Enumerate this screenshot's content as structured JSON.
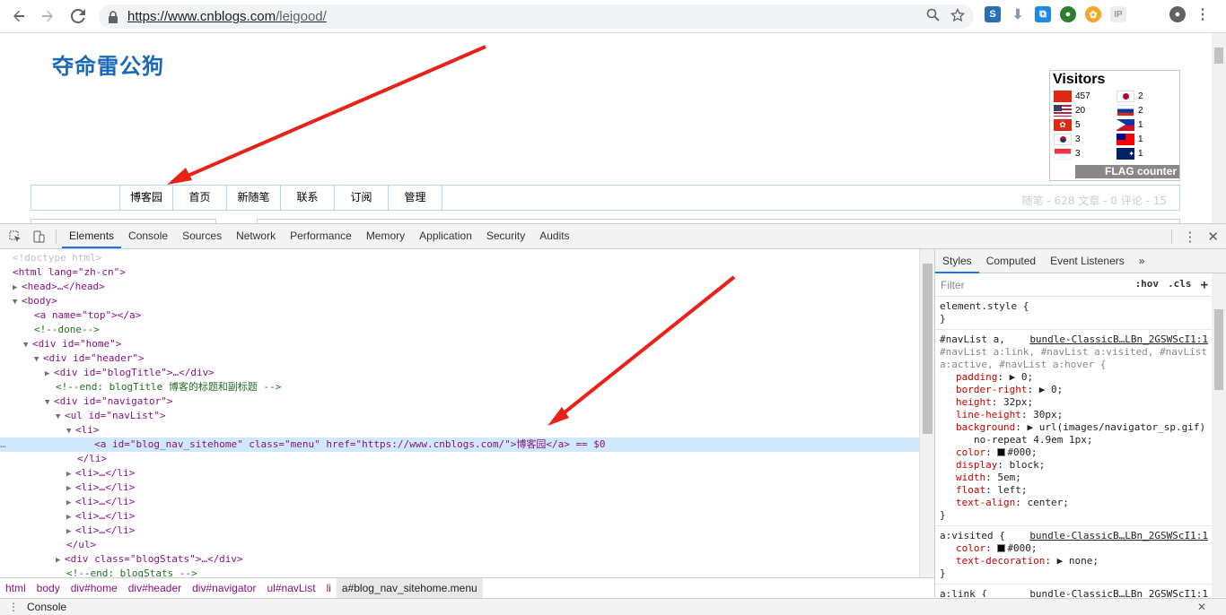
{
  "browser": {
    "url_host": "https://www.cnblogs.com",
    "url_path": "/leigood/"
  },
  "page": {
    "blog_title": "夺命雷公狗",
    "nav_items": [
      "博客园",
      "首页",
      "新随笔",
      "联系",
      "订阅",
      "管理"
    ],
    "blog_stats": "随笔 - 628  文章 - 0  评论 - 15"
  },
  "flag_counter": {
    "title": "Visitors",
    "rows": [
      {
        "flag": "china",
        "count": "457"
      },
      {
        "flag": "usa",
        "count": "20"
      },
      {
        "flag": "hongkong",
        "count": "5"
      },
      {
        "flag": "korea",
        "count": "3"
      },
      {
        "flag": "singapore",
        "count": "3"
      },
      {
        "flag": "japan",
        "count": "2"
      },
      {
        "flag": "russia",
        "count": "2"
      },
      {
        "flag": "philippines",
        "count": "1"
      },
      {
        "flag": "taiwan",
        "count": "1"
      },
      {
        "flag": "australia",
        "count": "1"
      }
    ],
    "logo_text": "FLAG counter"
  },
  "devtools": {
    "tabs": [
      "Elements",
      "Console",
      "Sources",
      "Network",
      "Performance",
      "Memory",
      "Application",
      "Security",
      "Audits"
    ],
    "active_tab": "Elements",
    "dom_lines": [
      {
        "text": "<!doctype html>"
      },
      {
        "text": "<html lang=\"zh-cn\">"
      },
      {
        "text": "<head>…</head>"
      },
      {
        "text": "<body>"
      },
      {
        "text": "<a name=\"top\"></a>"
      },
      {
        "text": "<!--done-->"
      },
      {
        "text": "<div id=\"home\">"
      },
      {
        "text": "<div id=\"header\">"
      },
      {
        "text": "<div id=\"blogTitle\">…</div>"
      },
      {
        "text": "<!--end: blogTitle 博客的标题和副标题 -->"
      },
      {
        "text": "<div id=\"navigator\">"
      },
      {
        "text": "<ul id=\"navList\">"
      },
      {
        "text": "<li>"
      },
      {
        "text": "<a id=\"blog_nav_sitehome\" class=\"menu\" href=\"https://www.cnblogs.com/\">博客园</a> == $0"
      },
      {
        "text": "</li>"
      },
      {
        "text": "<li>…</li>"
      },
      {
        "text": "<li>…</li>"
      },
      {
        "text": "<li>…</li>"
      },
      {
        "text": "<li>…</li>"
      },
      {
        "text": "<li>…</li>"
      },
      {
        "text": "</ul>"
      },
      {
        "text": "<div class=\"blogStats\">…</div>"
      },
      {
        "text": "<!--end: blogStats -->"
      }
    ],
    "breadcrumbs": [
      "html",
      "body",
      "div#home",
      "div#header",
      "div#navigator",
      "ul#navList",
      "li",
      "a#blog_nav_sitehome.menu"
    ],
    "styles_tabs": [
      "Styles",
      "Computed",
      "Event Listeners"
    ],
    "filter_placeholder": "Filter",
    "hov_label": ":hov",
    "cls_label": ".cls",
    "element_style": "element.style {",
    "rule1_selector_a": "#navList a,",
    "rule1_selector_b": "#navList a:link, #navList a:visited, #navList",
    "rule1_selector_c": "a:active, #navList a:hover {",
    "rule1_source": "bundle-ClassicB…LBn_2GSWScI1:1",
    "rule1_props": [
      {
        "name": "padding",
        "value": "▶ 0;"
      },
      {
        "name": "border-right",
        "value": "▶ 0;"
      },
      {
        "name": "height",
        "value": "32px;"
      },
      {
        "name": "line-height",
        "value": "30px;"
      },
      {
        "name": "background",
        "value": "▶ url(images/navigator_sp.gif)"
      },
      {
        "name": "",
        "value": "no-repeat 4.9em 1px;"
      },
      {
        "name": "color",
        "value": "#000;"
      },
      {
        "name": "display",
        "value": "block;"
      },
      {
        "name": "width",
        "value": "5em;"
      },
      {
        "name": "float",
        "value": "left;"
      },
      {
        "name": "text-align",
        "value": "center;"
      }
    ],
    "rule2_selector": "a:visited {",
    "rule2_source": "bundle-ClassicB…LBn_2GSWScI1:1",
    "rule2_props": [
      {
        "name": "color",
        "value": "#000;"
      },
      {
        "name": "text-decoration",
        "value": "▶ none;"
      }
    ],
    "rule3_selector": "a:link {",
    "rule3_source": "bundle-ClassicB…LBn_2GSWScI1:1",
    "drawer_label": "Console"
  },
  "colors": {
    "accent": "#1a73e8",
    "blog_title": "#1a68b8",
    "arrow": "#e8221b"
  }
}
